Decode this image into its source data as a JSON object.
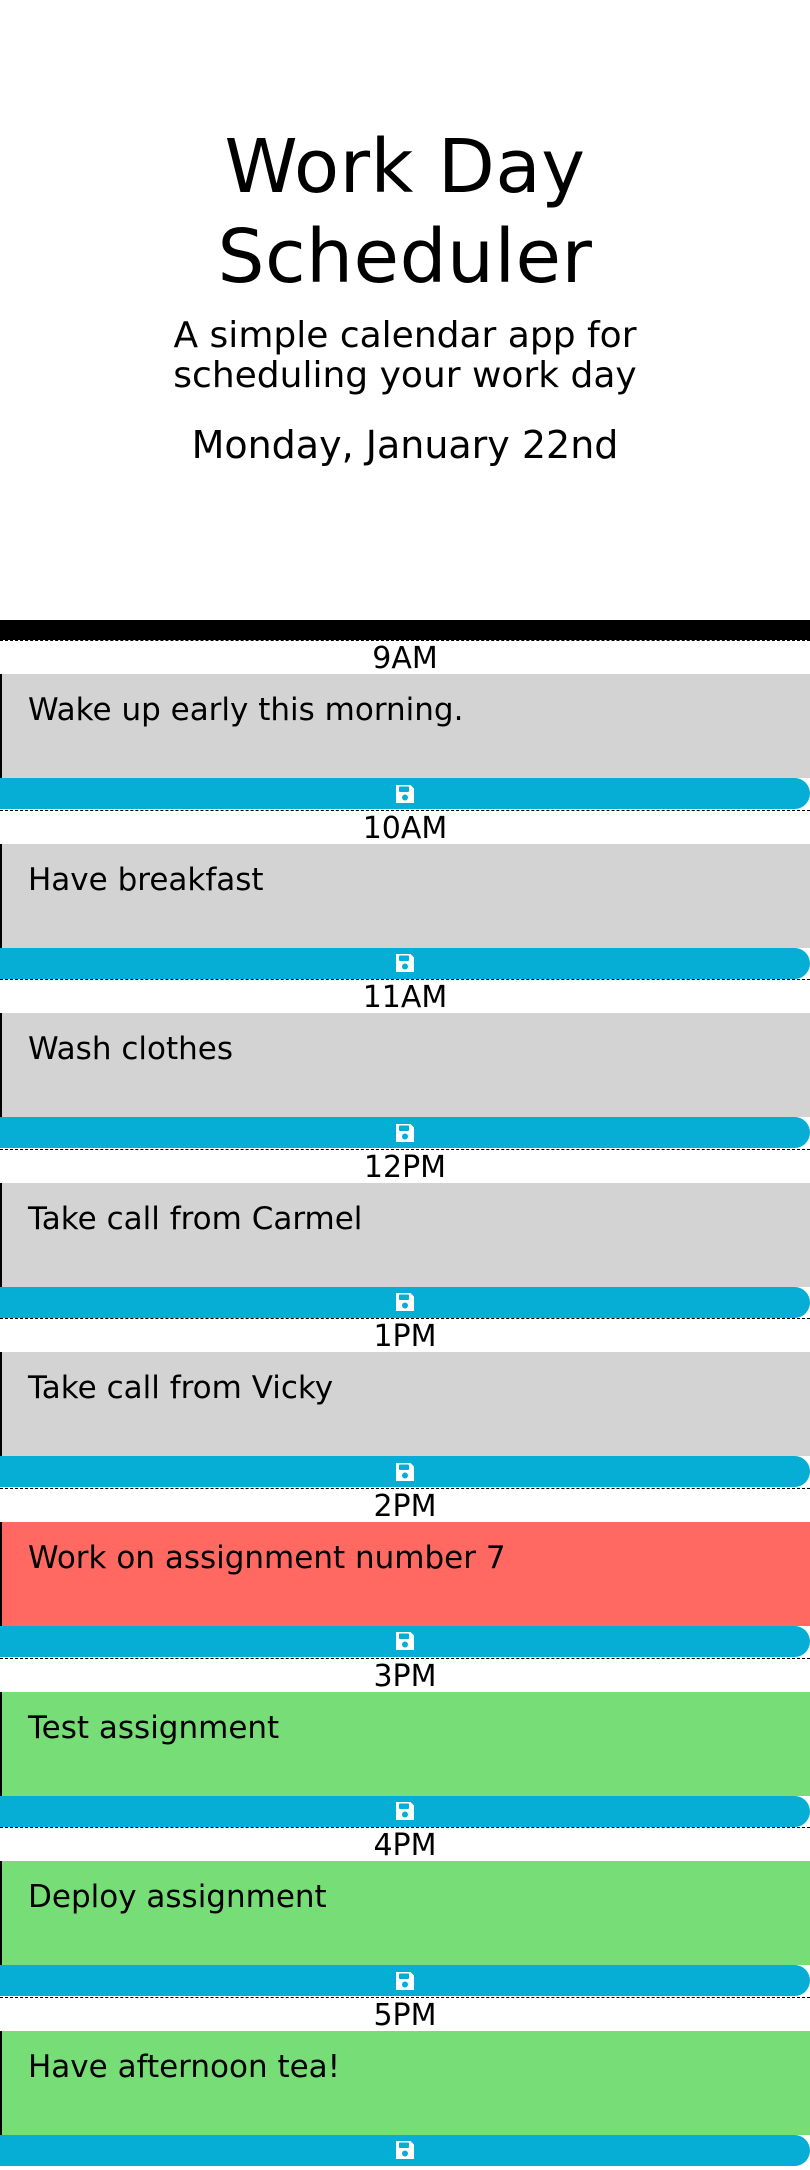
{
  "header": {
    "title": "Work Day Scheduler",
    "subtitle": "A simple calendar app for scheduling your work day",
    "current_day": "Monday, January 22nd"
  },
  "colors": {
    "past": "#d3d3d3",
    "present": "#ff6961",
    "future": "#77dd77",
    "save": "#06aed5"
  },
  "hours": [
    {
      "label": "9AM",
      "text": "Wake up early this morning.",
      "state": "past",
      "icon": "save-icon"
    },
    {
      "label": "10AM",
      "text": "Have breakfast",
      "state": "past",
      "icon": "save-icon"
    },
    {
      "label": "11AM",
      "text": "Wash clothes",
      "state": "past",
      "icon": "save-icon"
    },
    {
      "label": "12PM",
      "text": "Take call from Carmel",
      "state": "past",
      "icon": "save-icon"
    },
    {
      "label": "1PM",
      "text": "Take call from Vicky",
      "state": "past",
      "icon": "save-icon"
    },
    {
      "label": "2PM",
      "text": "Work on assignment number 7",
      "state": "present",
      "icon": "save-icon"
    },
    {
      "label": "3PM",
      "text": "Test assignment",
      "state": "future",
      "icon": "save-icon"
    },
    {
      "label": "4PM",
      "text": "Deploy assignment",
      "state": "future",
      "icon": "save-icon"
    },
    {
      "label": "5PM",
      "text": "Have afternoon tea!",
      "state": "future",
      "icon": "save-icon"
    }
  ]
}
